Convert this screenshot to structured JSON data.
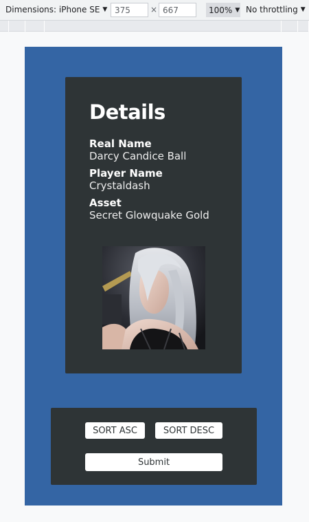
{
  "devtools": {
    "device_label": "Dimensions: iPhone SE",
    "width_value": "375",
    "height_value": "667",
    "times": "×",
    "zoom": "100%",
    "throttling": "No throttling",
    "dropdown_arrow": "▼"
  },
  "details": {
    "title": "Details",
    "real_name_label": "Real Name",
    "real_name_value": "Darcy Candice Ball",
    "player_name_label": "Player Name",
    "player_name_value": "Crystaldash",
    "asset_label": "Asset",
    "asset_value": "Secret Glowquake Gold"
  },
  "controls": {
    "sort_asc_label": "SORT ASC",
    "sort_desc_label": "SORT DESC",
    "submit_label": "Submit"
  },
  "colors": {
    "viewport_bg": "#3465a4",
    "card_bg": "#2e3436",
    "button_bg": "#ffffff"
  }
}
